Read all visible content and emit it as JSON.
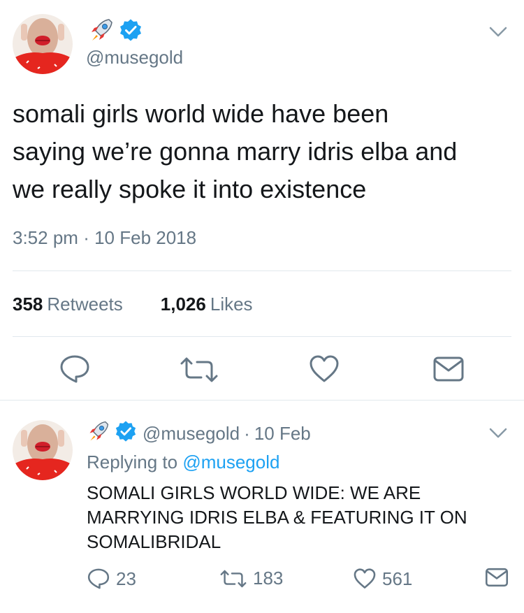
{
  "main_tweet": {
    "handle": "@musegold",
    "text": "somali girls world wide have been\nsaying we’re gonna marry idris elba and\nwe really spoke it into existence",
    "time": "3:52 pm",
    "date_separator": "·",
    "date": "10 Feb 2018",
    "retweets_count": "358",
    "retweets_label": "Retweets",
    "likes_count": "1,026",
    "likes_label": "Likes"
  },
  "reply_tweet": {
    "handle": "@musegold",
    "separator": "·",
    "date": "10 Feb",
    "replying_prefix": "Replying to",
    "replying_handle": "@musegold",
    "text": "SOMALI GIRLS WORLD WIDE: WE ARE\nMARRYING IDRIS ELBA & FEATURING IT ON\nSOMALIBRIDAL",
    "reply_count": "23",
    "retweet_count": "183",
    "like_count": "561"
  },
  "colors": {
    "text": "#14171a",
    "secondary": "#657786",
    "link": "#1da1f2",
    "divider": "#e1e8ed",
    "avatar_bg": "#e5261f"
  },
  "icons": {
    "header": [
      "rocket-emoji-icon",
      "verified-badge-icon"
    ],
    "actions": [
      "reply-icon",
      "retweet-icon",
      "like-icon",
      "direct-message-icon"
    ],
    "menu": "chevron-down-icon"
  }
}
